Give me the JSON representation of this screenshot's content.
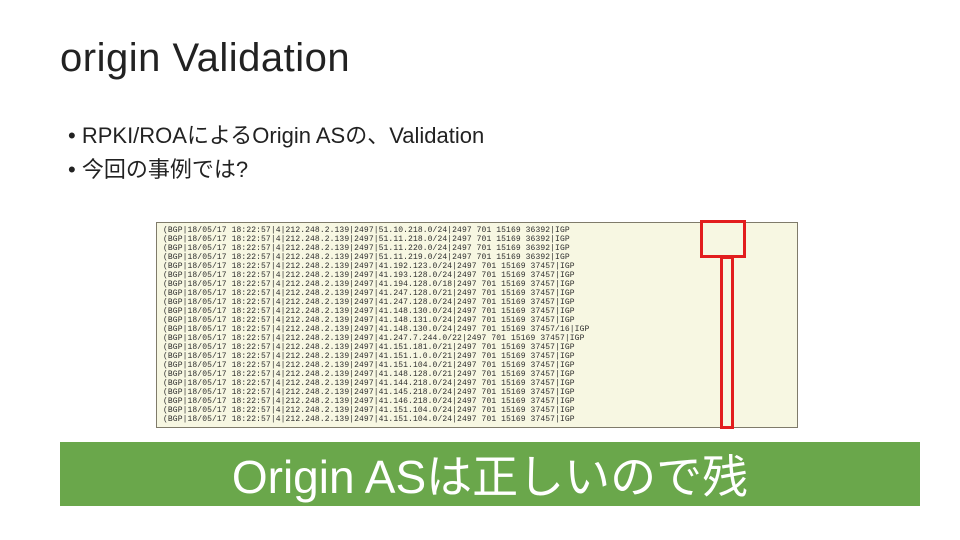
{
  "title": "origin Validation",
  "bullets": {
    "b1": "RPKI/ROAによるOrigin ASの、Validation",
    "b2": "今回の事例では?"
  },
  "highlighted_column": "AS",
  "log_lines": [
    "(BGP|18/05/17 18:22:57|4|212.248.2.139|2497|51.10.218.0/24|2497 701 15169 36392|IGP",
    "(BGP|18/05/17 18:22:57|4|212.248.2.139|2497|51.11.218.0/24|2497 701 15169 36392|IGP",
    "(BGP|18/05/17 18:22:57|4|212.248.2.139|2497|51.11.220.0/24|2497 701 15169 36392|IGP",
    "(BGP|18/05/17 18:22:57|4|212.248.2.139|2497|51.11.219.0/24|2497 701 15169 36392|IGP",
    "(BGP|18/05/17 18:22:57|4|212.248.2.139|2497|41.192.123.0/24|2497 701 15169 37457|IGP",
    "(BGP|18/05/17 18:22:57|4|212.248.2.139|2497|41.193.128.0/24|2497 701 15169 37457|IGP",
    "(BGP|18/05/17 18:22:57|4|212.248.2.139|2497|41.194.128.0/18|2497 701 15169 37457|IGP",
    "(BGP|18/05/17 18:22:57|4|212.248.2.139|2497|41.247.128.0/21|2497 701 15169 37457|IGP",
    "(BGP|18/05/17 18:22:57|4|212.248.2.139|2497|41.247.128.0/24|2497 701 15169 37457|IGP",
    "(BGP|18/05/17 18:22:57|4|212.248.2.139|2497|41.148.130.0/24|2497 701 15169 37457|IGP",
    "(BGP|18/05/17 18:22:57|4|212.248.2.139|2497|41.148.131.0/24|2497 701 15169 37457|IGP",
    "(BGP|18/05/17 18:22:57|4|212.248.2.139|2497|41.148.130.0/24|2497 701 15169 37457/16|IGP",
    "(BGP|18/05/17 18:22:57|4|212.248.2.139|2497|41.247.7.244.0/22|2497 701 15169 37457|IGP",
    "(BGP|18/05/17 18:22:57|4|212.248.2.139|2497|41.151.181.0/21|2497 701 15169 37457|IGP",
    "(BGP|18/05/17 18:22:57|4|212.248.2.139|2497|41.151.1.0.0/21|2497 701 15169 37457|IGP",
    "(BGP|18/05/17 18:22:57|4|212.248.2.139|2497|41.151.104.0/21|2497 701 15169 37457|IGP",
    "(BGP|18/05/17 18:22:57|4|212.248.2.139|2497|41.148.128.0/21|2497 701 15169 37457|IGP",
    "(BGP|18/05/17 18:22:57|4|212.248.2.139|2497|41.144.218.0/24|2497 701 15169 37457|IGP",
    "(BGP|18/05/17 18:22:57|4|212.248.2.139|2497|41.145.218.0/24|2497 701 15169 37457|IGP",
    "(BGP|18/05/17 18:22:57|4|212.248.2.139|2497|41.146.218.0/24|2497 701 15169 37457|IGP",
    "(BGP|18/05/17 18:22:57|4|212.248.2.139|2497|41.151.104.0/24|2497 701 15169 37457|IGP",
    "(BGP|18/05/17 18:22:57|4|212.248.2.139|2497|41.151.104.0/24|2497 701 15169 37457|IGP"
  ],
  "banner": "Origin ASは正しいので残"
}
